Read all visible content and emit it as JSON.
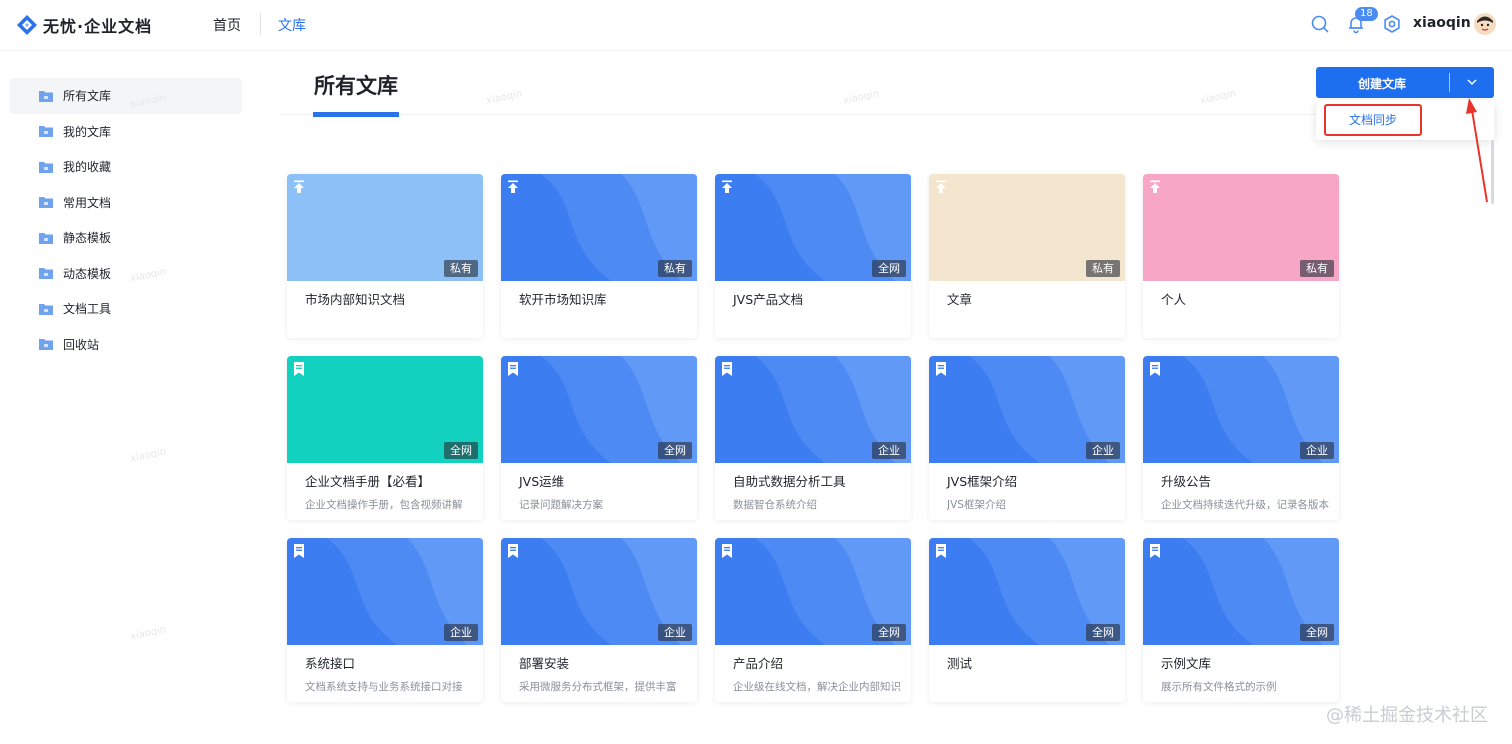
{
  "header": {
    "logo_text": "无忧·企业文档",
    "nav": [
      {
        "label": "首页",
        "active": false
      },
      {
        "label": "文库",
        "active": true
      }
    ],
    "notification_count": "18",
    "username": "xiaoqin",
    "accent_color": "#2a73e8"
  },
  "sidebar": {
    "items": [
      {
        "label": "所有文库",
        "active": true
      },
      {
        "label": "我的文库"
      },
      {
        "label": "我的收藏"
      },
      {
        "label": "常用文档"
      },
      {
        "label": "静态模板"
      },
      {
        "label": "动态模板"
      },
      {
        "label": "文档工具"
      },
      {
        "label": "回收站"
      }
    ]
  },
  "main": {
    "title": "所有文库",
    "create_button": "创建文库",
    "dropdown_item": "文档同步"
  },
  "watermark": "xiaoqin",
  "footer_mark": "@稀土掘金技术社区",
  "cards": [
    {
      "title": "市场内部知识文档",
      "desc": "",
      "tag": "私有",
      "cover": "light-blue",
      "icon": "pin-icon"
    },
    {
      "title": "软开市场知识库",
      "desc": "",
      "tag": "私有",
      "cover": "blue",
      "icon": "pin-icon"
    },
    {
      "title": "JVS产品文档",
      "desc": "",
      "tag": "全网",
      "cover": "blue",
      "icon": "pin-icon"
    },
    {
      "title": "文章",
      "desc": "",
      "tag": "私有",
      "cover": "beige",
      "icon": "pin-icon"
    },
    {
      "title": "个人",
      "desc": "",
      "tag": "私有",
      "cover": "pink",
      "icon": "pin-icon"
    },
    {
      "title": "企业文档手册【必看】",
      "desc": "企业文档操作手册，包含视频讲解",
      "tag": "全网",
      "cover": "teal",
      "icon": "bookmark-icon"
    },
    {
      "title": "JVS运维",
      "desc": "记录问题解决方案",
      "tag": "全网",
      "cover": "blue",
      "icon": "bookmark-icon"
    },
    {
      "title": "自助式数据分析工具",
      "desc": "数据智仓系统介绍",
      "tag": "企业",
      "cover": "blue",
      "icon": "bookmark-icon"
    },
    {
      "title": "JVS框架介绍",
      "desc": "JVS框架介绍",
      "tag": "企业",
      "cover": "blue",
      "icon": "bookmark-icon"
    },
    {
      "title": "升级公告",
      "desc": "企业文档持续迭代升级，记录各版本",
      "tag": "企业",
      "cover": "blue",
      "icon": "bookmark-icon"
    },
    {
      "title": "系统接口",
      "desc": "文档系统支持与业务系统接口对接",
      "tag": "企业",
      "cover": "blue",
      "icon": "bookmark-icon"
    },
    {
      "title": "部署安装",
      "desc": "采用微服务分布式框架，提供丰富",
      "tag": "企业",
      "cover": "blue",
      "icon": "bookmark-icon"
    },
    {
      "title": "产品介绍",
      "desc": "企业级在线文档，解决企业内部知识",
      "tag": "全网",
      "cover": "blue",
      "icon": "bookmark-icon"
    },
    {
      "title": "测试",
      "desc": "",
      "tag": "全网",
      "cover": "blue",
      "icon": "bookmark-icon"
    },
    {
      "title": "示例文库",
      "desc": "展示所有文件格式的示例",
      "tag": "全网",
      "cover": "blue",
      "icon": "bookmark-icon"
    }
  ],
  "cover_colors": {
    "light-blue": "#8cc0f7",
    "blue": "#3d7df2",
    "beige": "#f3e5ce",
    "pink": "#f7a7c5",
    "teal": "#12d2bf"
  }
}
